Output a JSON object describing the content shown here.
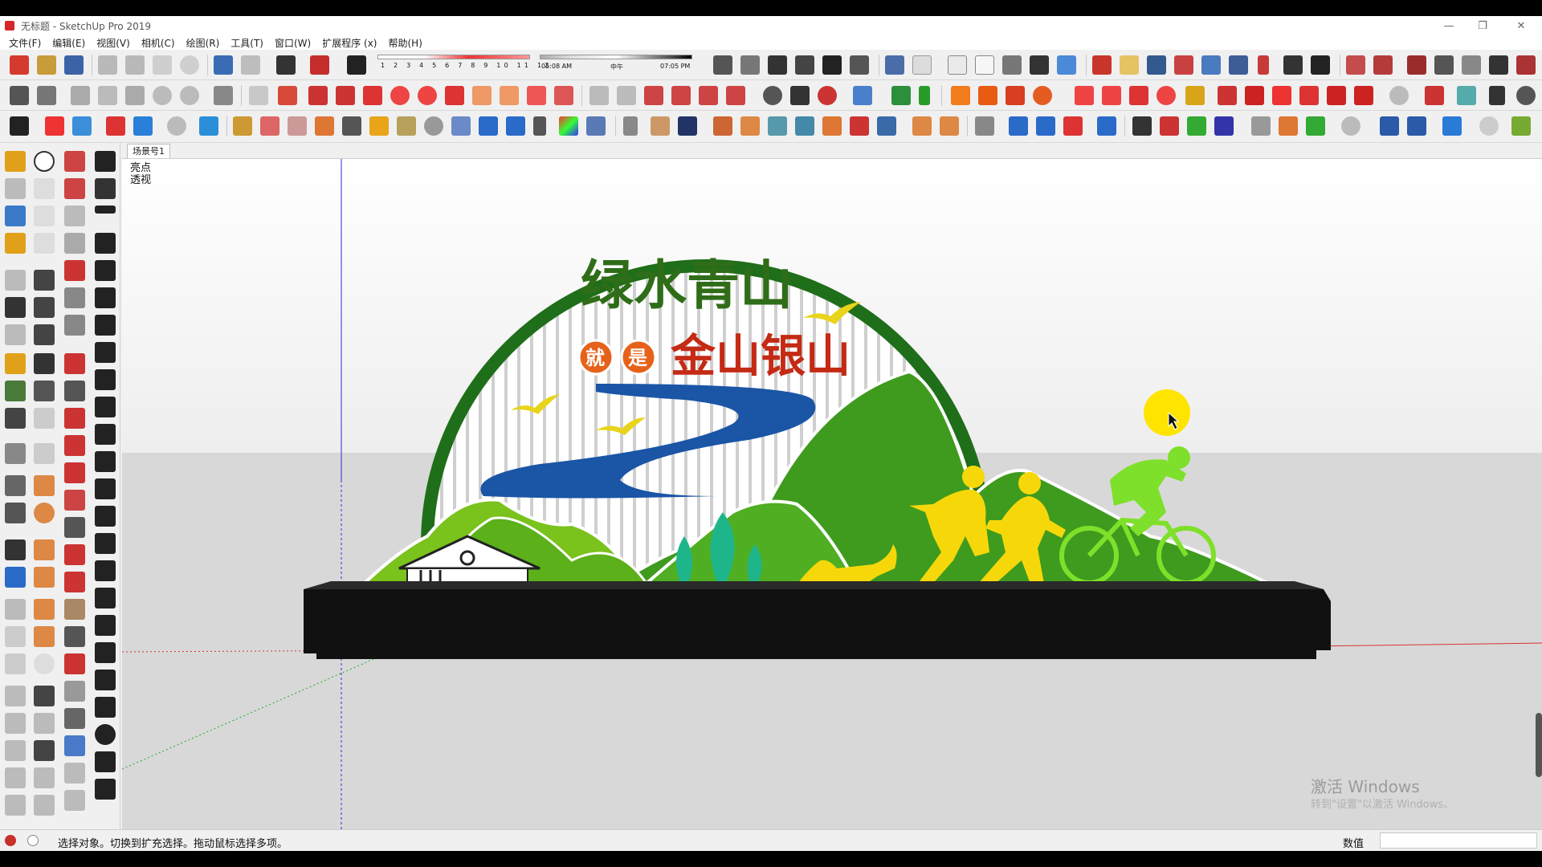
{
  "app": {
    "title": "无标题 - SketchUp Pro 2019"
  },
  "menu": [
    "文件(F)",
    "编辑(E)",
    "视图(V)",
    "相机(C)",
    "绘图(R)",
    "工具(T)",
    "窗口(W)",
    "扩展程序 (x)",
    "帮助(H)"
  ],
  "shadow": {
    "months": "1 2 3 4 5 6 7 8 9 10 11 12",
    "time_start": "05:08 AM",
    "time_mid": "中午",
    "time_end": "07:05 PM"
  },
  "scene": {
    "tab_label": "场景号1",
    "style_line1": "亮点",
    "style_line2": "透视"
  },
  "sign": {
    "title_line1": "绿水青山",
    "badge1": "就",
    "badge2": "是",
    "title_line2": "金山银山"
  },
  "status": {
    "message": "选择对象。切换到扩充选择。拖动鼠标选择多项。",
    "measure_label": "数值",
    "measure_value": ""
  },
  "watermark": {
    "line1": "激活 Windows",
    "line2": "转到\"设置\"以激活 Windows。"
  },
  "colors": {
    "dark_green": "#1f6e1a",
    "mid_green": "#3f9b1e",
    "light_green": "#7ac21c",
    "river_blue": "#1a55a6",
    "figure_yellow": "#f6d80a",
    "cyclist_green": "#7ee02a",
    "title_red": "#c42a14",
    "base_black": "#111111",
    "cursor_halo": "#ffe400"
  },
  "icons": {
    "toolbar": [
      "select-icon",
      "eraser-icon",
      "paint-bucket-icon",
      "line-icon",
      "rectangle-icon",
      "circle-icon",
      "push-pull-icon",
      "move-icon",
      "rotate-icon",
      "scale-icon",
      "tape-measure-icon",
      "orbit-icon",
      "pan-icon",
      "zoom-icon",
      "zoom-extents-icon"
    ]
  }
}
